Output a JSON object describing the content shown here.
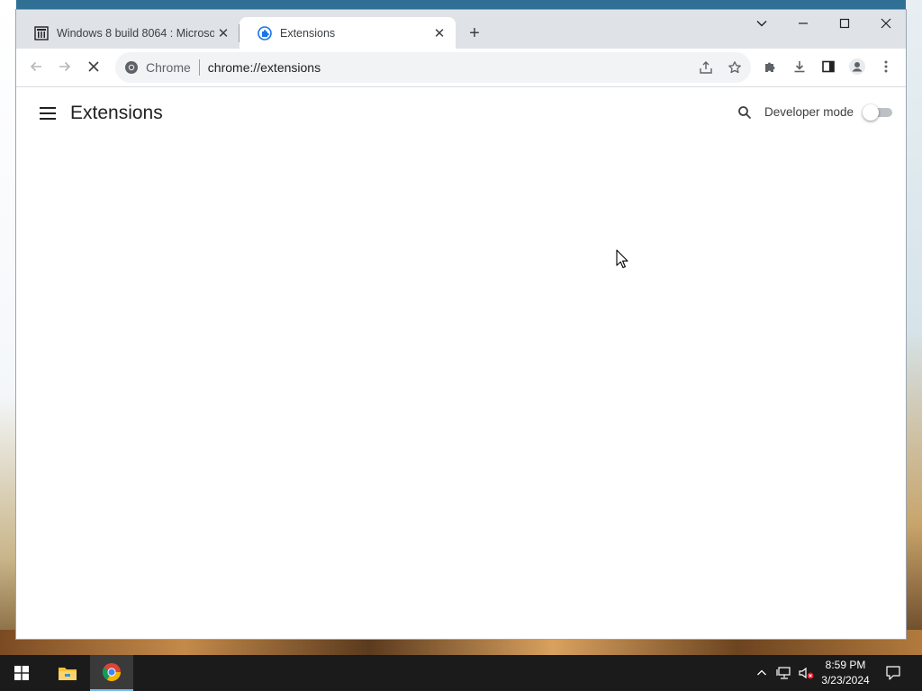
{
  "browser": {
    "tabs": [
      {
        "title": "Windows 8 build 8064 : Microsof",
        "icon": "archive-icon",
        "active": false
      },
      {
        "title": "Extensions",
        "icon": "extensions-puzzle-icon",
        "active": true
      }
    ],
    "omnibox": {
      "site_label": "Chrome",
      "url": "chrome://extensions"
    }
  },
  "page": {
    "title": "Extensions",
    "developer_mode_label": "Developer mode",
    "developer_mode_enabled": false
  },
  "taskbar": {
    "items": [
      "start-icon",
      "file-explorer-icon",
      "chrome-icon"
    ],
    "clock_time": "8:59 PM",
    "clock_date": "3/23/2024"
  },
  "colors": {
    "accent": "#1a73e8",
    "titlebar": "#dfe3e8",
    "taskbar": "#1b1b1b"
  }
}
